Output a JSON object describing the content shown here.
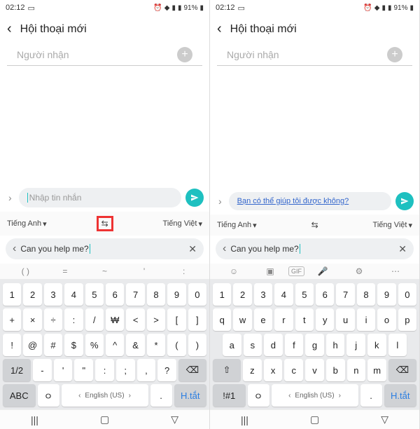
{
  "status": {
    "time": "02:12",
    "battery": "91%"
  },
  "header": {
    "title": "Hội thoại mới"
  },
  "recipient": {
    "label": "Người nhận"
  },
  "compose": {
    "placeholder": "Nhập tin nhắn",
    "translated": "Bạn có thể giúp tôi được không?"
  },
  "translate": {
    "source": "Tiếng Anh",
    "target": "Tiếng Việt",
    "input": "Can you help me?"
  },
  "toolbar_sym": {
    "k1": "( )",
    "k2": "=",
    "k3": "~",
    "k4": "'",
    "k5": ":"
  },
  "kb": {
    "row1": [
      "1",
      "2",
      "3",
      "4",
      "5",
      "6",
      "7",
      "8",
      "9",
      "0"
    ],
    "left_sym": {
      "r2": [
        "+",
        "×",
        "÷",
        ":",
        "/",
        "₩",
        "<",
        ">",
        "[",
        "]"
      ],
      "r3": [
        "!",
        "@",
        "#",
        "$",
        "%",
        "^",
        "&",
        "*",
        "(",
        ")"
      ],
      "r4": [
        "-",
        "'",
        "\"",
        ":",
        ";",
        ",",
        "?"
      ],
      "mode": "1/2",
      "abc": "ABC"
    },
    "right_sym": {
      "r2": [
        "q",
        "w",
        "e",
        "r",
        "t",
        "y",
        "u",
        "i",
        "o",
        "p"
      ],
      "r3": [
        "a",
        "s",
        "d",
        "f",
        "g",
        "h",
        "j",
        "k",
        "l"
      ],
      "r4": [
        "z",
        "x",
        "c",
        "v",
        "b",
        "n",
        "m"
      ],
      "mode": "!#1"
    },
    "space": "English (US)",
    "dot": ".",
    "comma": ",",
    "htat": "H.tắt",
    "ground": "ㅇ"
  }
}
